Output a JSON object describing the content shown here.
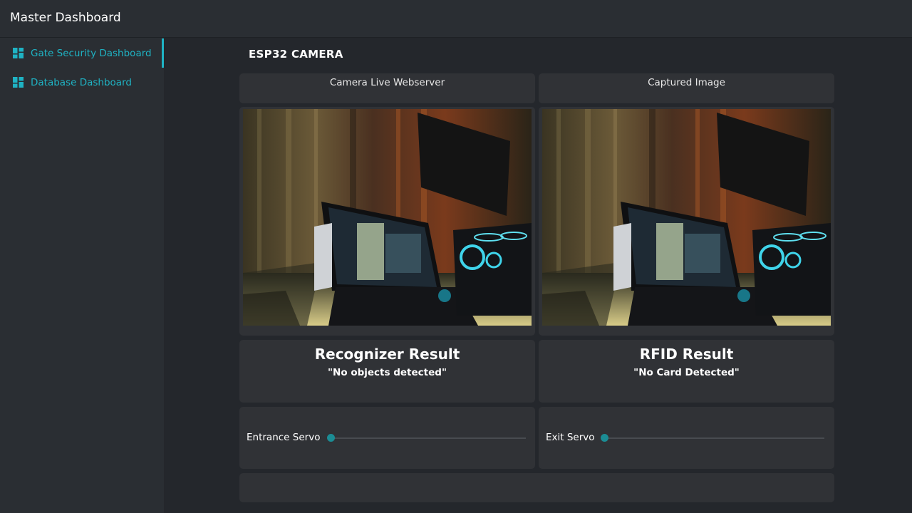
{
  "app": {
    "title": "Master Dashboard"
  },
  "sidebar": {
    "items": [
      {
        "label": "Gate Security Dashboard",
        "icon": "dashboard-icon",
        "active": true
      },
      {
        "label": "Database Dashboard",
        "icon": "dashboard-icon",
        "active": false
      }
    ]
  },
  "main": {
    "section_title": "ESP32 CAMERA",
    "live_card": {
      "title": "Camera Live Webserver"
    },
    "captured_card": {
      "title": "Captured Image"
    },
    "recognizer": {
      "title": "Recognizer Result",
      "value": "\"No objects detected\""
    },
    "rfid": {
      "title": "RFID Result",
      "value": "\"No Card Detected\""
    },
    "entrance_servo": {
      "label": "Entrance Servo",
      "value": 0
    },
    "exit_servo": {
      "label": "Exit Servo",
      "value": 0
    }
  },
  "colors": {
    "accent": "#1fb3c4",
    "slider_thumb": "#1b8c94",
    "background": "#24272c",
    "panel": "#2a2e33",
    "card": "#303236"
  }
}
